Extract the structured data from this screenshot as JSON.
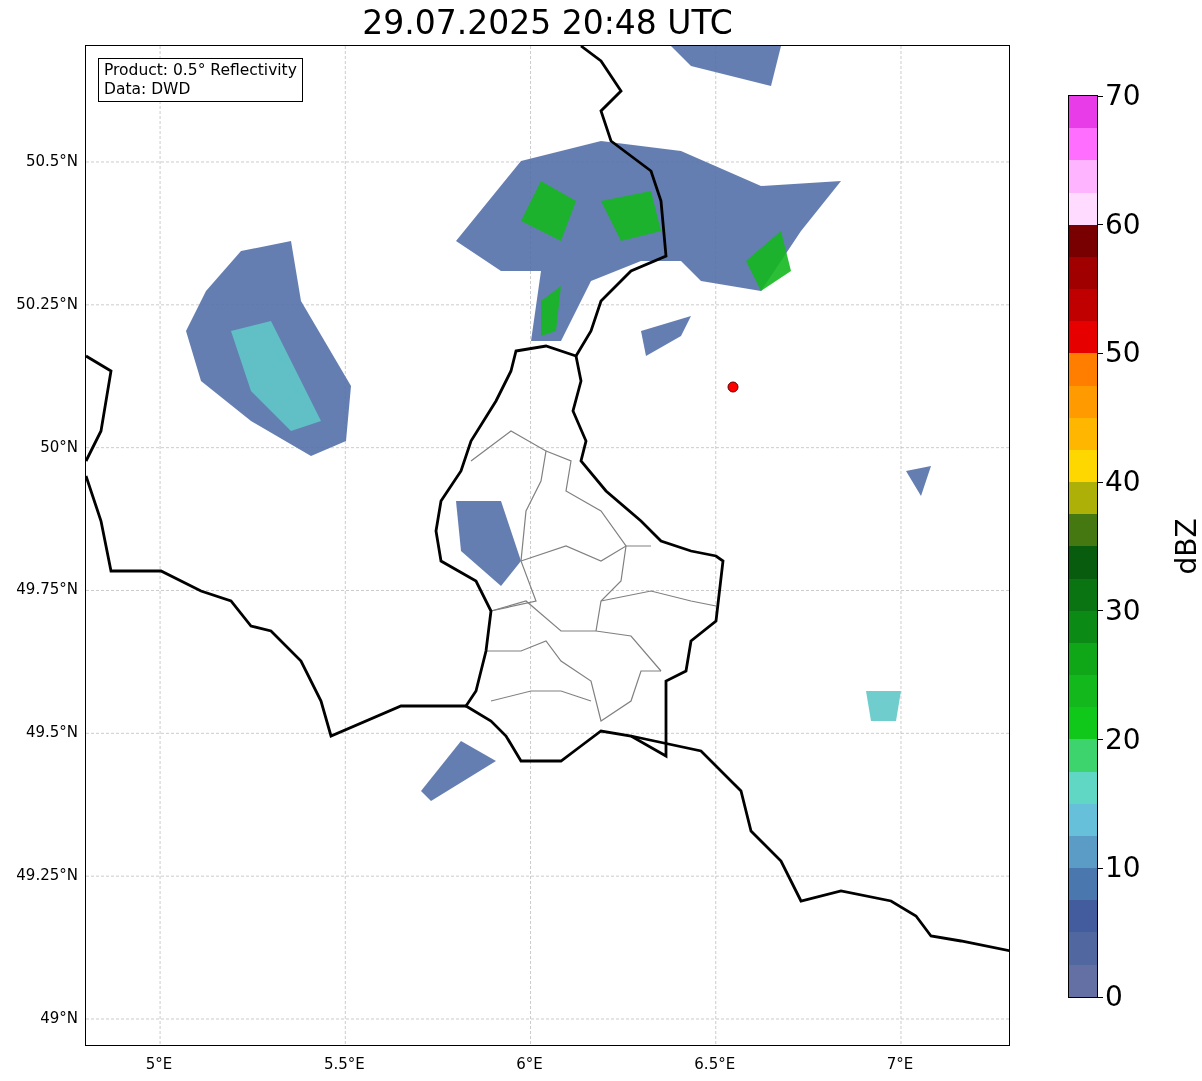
{
  "title": "29.07.2025 20:48 UTC",
  "info_box": {
    "lines": [
      "Product: 0.5° Reflectivity",
      "Data: DWD"
    ]
  },
  "map": {
    "y_ticks": [
      "50.5°N",
      "50.25°N",
      "50°N",
      "49.75°N",
      "49.5°N",
      "49.25°N",
      "49°N"
    ],
    "x_ticks": [
      "5°E",
      "5.5°E",
      "6°E",
      "6.5°E",
      "7°E"
    ]
  },
  "colorbar": {
    "label": "dBZ",
    "ticks": [
      "70",
      "60",
      "50",
      "40",
      "30",
      "20",
      "10",
      "0"
    ],
    "bands": [
      {
        "color": "#e83ce8"
      },
      {
        "color": "#ff6eff"
      },
      {
        "color": "#ffb4ff"
      },
      {
        "color": "#ffdcff"
      },
      {
        "color": "#780000"
      },
      {
        "color": "#a00000"
      },
      {
        "color": "#c00000"
      },
      {
        "color": "#e60000"
      },
      {
        "color": "#ff7e00"
      },
      {
        "color": "#ff9a00"
      },
      {
        "color": "#ffb600"
      },
      {
        "color": "#ffd700"
      },
      {
        "color": "#adb006"
      },
      {
        "color": "#467812"
      },
      {
        "color": "#075c0e"
      },
      {
        "color": "#0a7412"
      },
      {
        "color": "#0b8a16"
      },
      {
        "color": "#0fa618"
      },
      {
        "color": "#12b81c"
      },
      {
        "color": "#10c81a"
      },
      {
        "color": "#3dd46e"
      },
      {
        "color": "#60d6c4"
      },
      {
        "color": "#66c0da"
      },
      {
        "color": "#5a9cc5"
      },
      {
        "color": "#4a78ae"
      },
      {
        "color": "#435c9e"
      },
      {
        "color": "#51679f"
      },
      {
        "color": "#6470a4"
      }
    ]
  }
}
